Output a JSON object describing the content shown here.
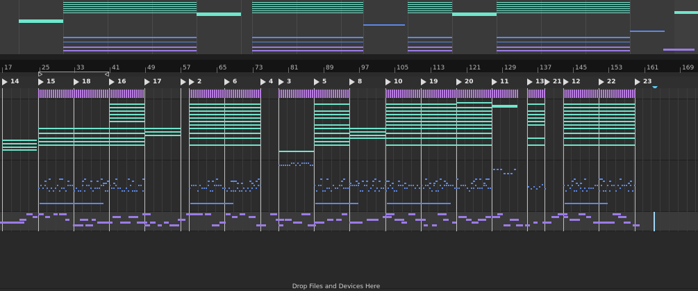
{
  "colors": {
    "midi_cyan": "#6fe6cc",
    "midi_blue": "#5d88e6",
    "midi_purple": "#9b7ce6",
    "midi_magenta": "#b77be0",
    "grid_line": "#3c3c3c",
    "locator_line": "#d8d8d8",
    "playhead": "#9fd7f5"
  },
  "beat_ruler": {
    "bars": [
      "17",
      "25",
      "33",
      "41",
      "49",
      "57",
      "65",
      "73",
      "81",
      "89",
      "97",
      "105",
      "113",
      "121",
      "129",
      "137",
      "145",
      "153",
      "161",
      "169"
    ]
  },
  "locators": [
    {
      "label": "14"
    },
    {
      "label": "15"
    },
    {
      "label": "18"
    },
    {
      "label": "16"
    },
    {
      "label": "17"
    },
    {
      "label": ""
    },
    {
      "label": "2"
    },
    {
      "label": "6"
    },
    {
      "label": "4"
    },
    {
      "label": "3"
    },
    {
      "label": "5"
    },
    {
      "label": "8"
    },
    {
      "label": "10"
    },
    {
      "label": "19"
    },
    {
      "label": "20"
    },
    {
      "label": "11"
    },
    {
      "label": "13"
    },
    {
      "label": "21"
    },
    {
      "label": "12"
    },
    {
      "label": "22"
    },
    {
      "label": "23"
    }
  ],
  "drop_area": {
    "text": "Drop Files and Devices Here"
  },
  "icons": {
    "locator_flag": "triangle-flag-icon",
    "loop_brace": "loop-brace-icon",
    "end_marker": "song-end-icon"
  }
}
